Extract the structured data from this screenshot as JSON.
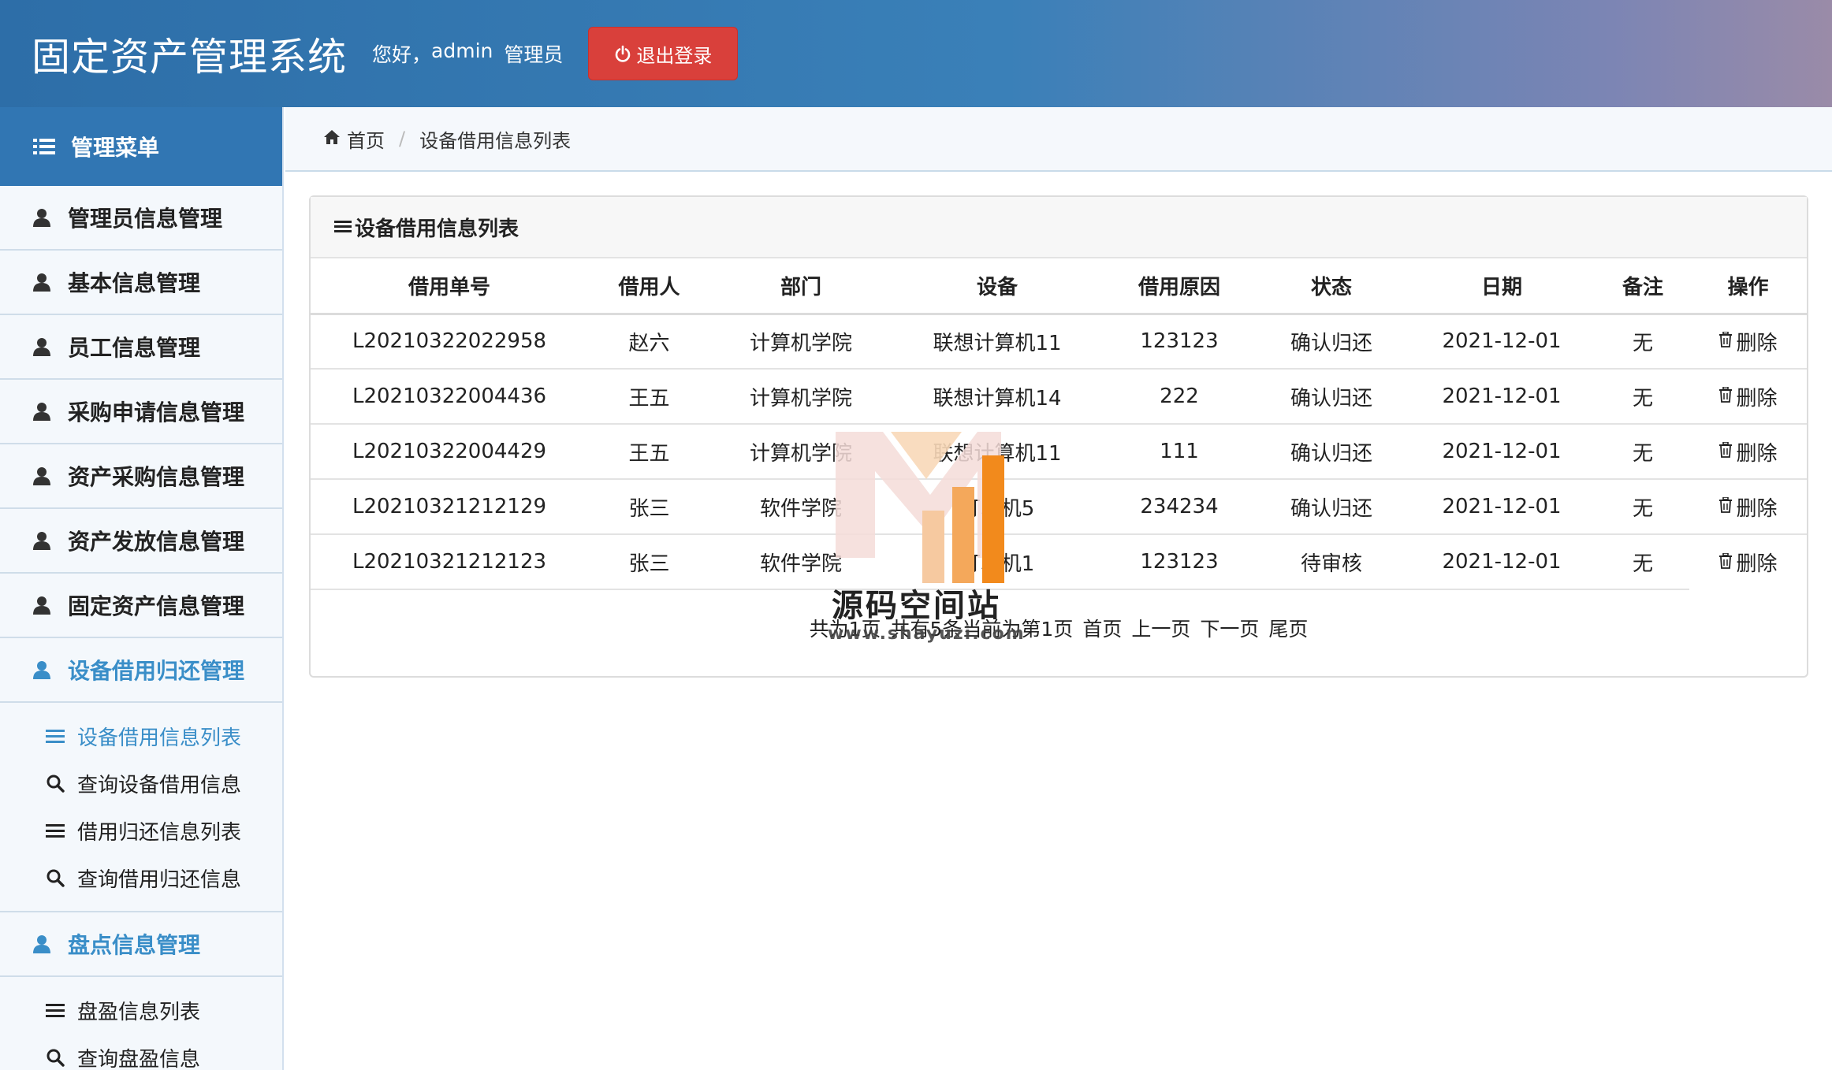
{
  "header": {
    "title": "固定资产管理系统",
    "greeting": "您好，",
    "username": "admin",
    "role": "管理员",
    "logout_label": "退出登录"
  },
  "sidebar": {
    "menu_title": "管理菜单",
    "items": [
      {
        "label": "管理员信息管理"
      },
      {
        "label": "基本信息管理"
      },
      {
        "label": "员工信息管理"
      },
      {
        "label": "采购申请信息管理"
      },
      {
        "label": "资产采购信息管理"
      },
      {
        "label": "资产发放信息管理"
      },
      {
        "label": "固定资产信息管理"
      },
      {
        "label": "设备借用归还管理"
      }
    ],
    "borrow_sub": [
      {
        "label": "设备借用信息列表"
      },
      {
        "label": "查询设备借用信息"
      },
      {
        "label": "借用归还信息列表"
      },
      {
        "label": "查询借用归还信息"
      }
    ],
    "inventory": {
      "label": "盘点信息管理"
    },
    "inventory_sub": [
      {
        "label": "盘盈信息列表"
      },
      {
        "label": "查询盘盈信息"
      }
    ]
  },
  "breadcrumb": {
    "home": "首页",
    "current": "设备借用信息列表"
  },
  "panel": {
    "title": "设备借用信息列表"
  },
  "table": {
    "headers": [
      "借用单号",
      "借用人",
      "部门",
      "设备",
      "借用原因",
      "状态",
      "日期",
      "备注",
      "操作"
    ],
    "delete_label": "删除",
    "rows": [
      [
        "L20210322022958",
        "赵六",
        "计算机学院",
        "联想计算机11",
        "123123",
        "确认归还",
        "2021-12-01",
        "无"
      ],
      [
        "L20210322004436",
        "王五",
        "计算机学院",
        "联想计算机14",
        "222",
        "确认归还",
        "2021-12-01",
        "无"
      ],
      [
        "L20210322004429",
        "王五",
        "计算机学院",
        "联想计算机11",
        "111",
        "确认归还",
        "2021-12-01",
        "无"
      ],
      [
        "L20210321212129",
        "张三",
        "软件学院",
        "打印机5",
        "234234",
        "确认归还",
        "2021-12-01",
        "无"
      ],
      [
        "L20210321212123",
        "张三",
        "软件学院",
        "打印机1",
        "123123",
        "待审核",
        "2021-12-01",
        "无"
      ]
    ]
  },
  "pager": {
    "total_pages": "共为1页",
    "total_items": "共有5条",
    "current": "当前为第1页",
    "first": "首页",
    "prev": "上一页",
    "next": "下一页",
    "last": "尾页"
  },
  "watermark": {
    "title": "源码空间站",
    "subtitle": "www.shayuzi.com"
  },
  "colors": {
    "header_start": "#2d6ea8",
    "header_end": "#9a8ba8",
    "logout": "#d9403b",
    "menu_head": "#3176b3",
    "active_link": "#3a8ec8"
  }
}
